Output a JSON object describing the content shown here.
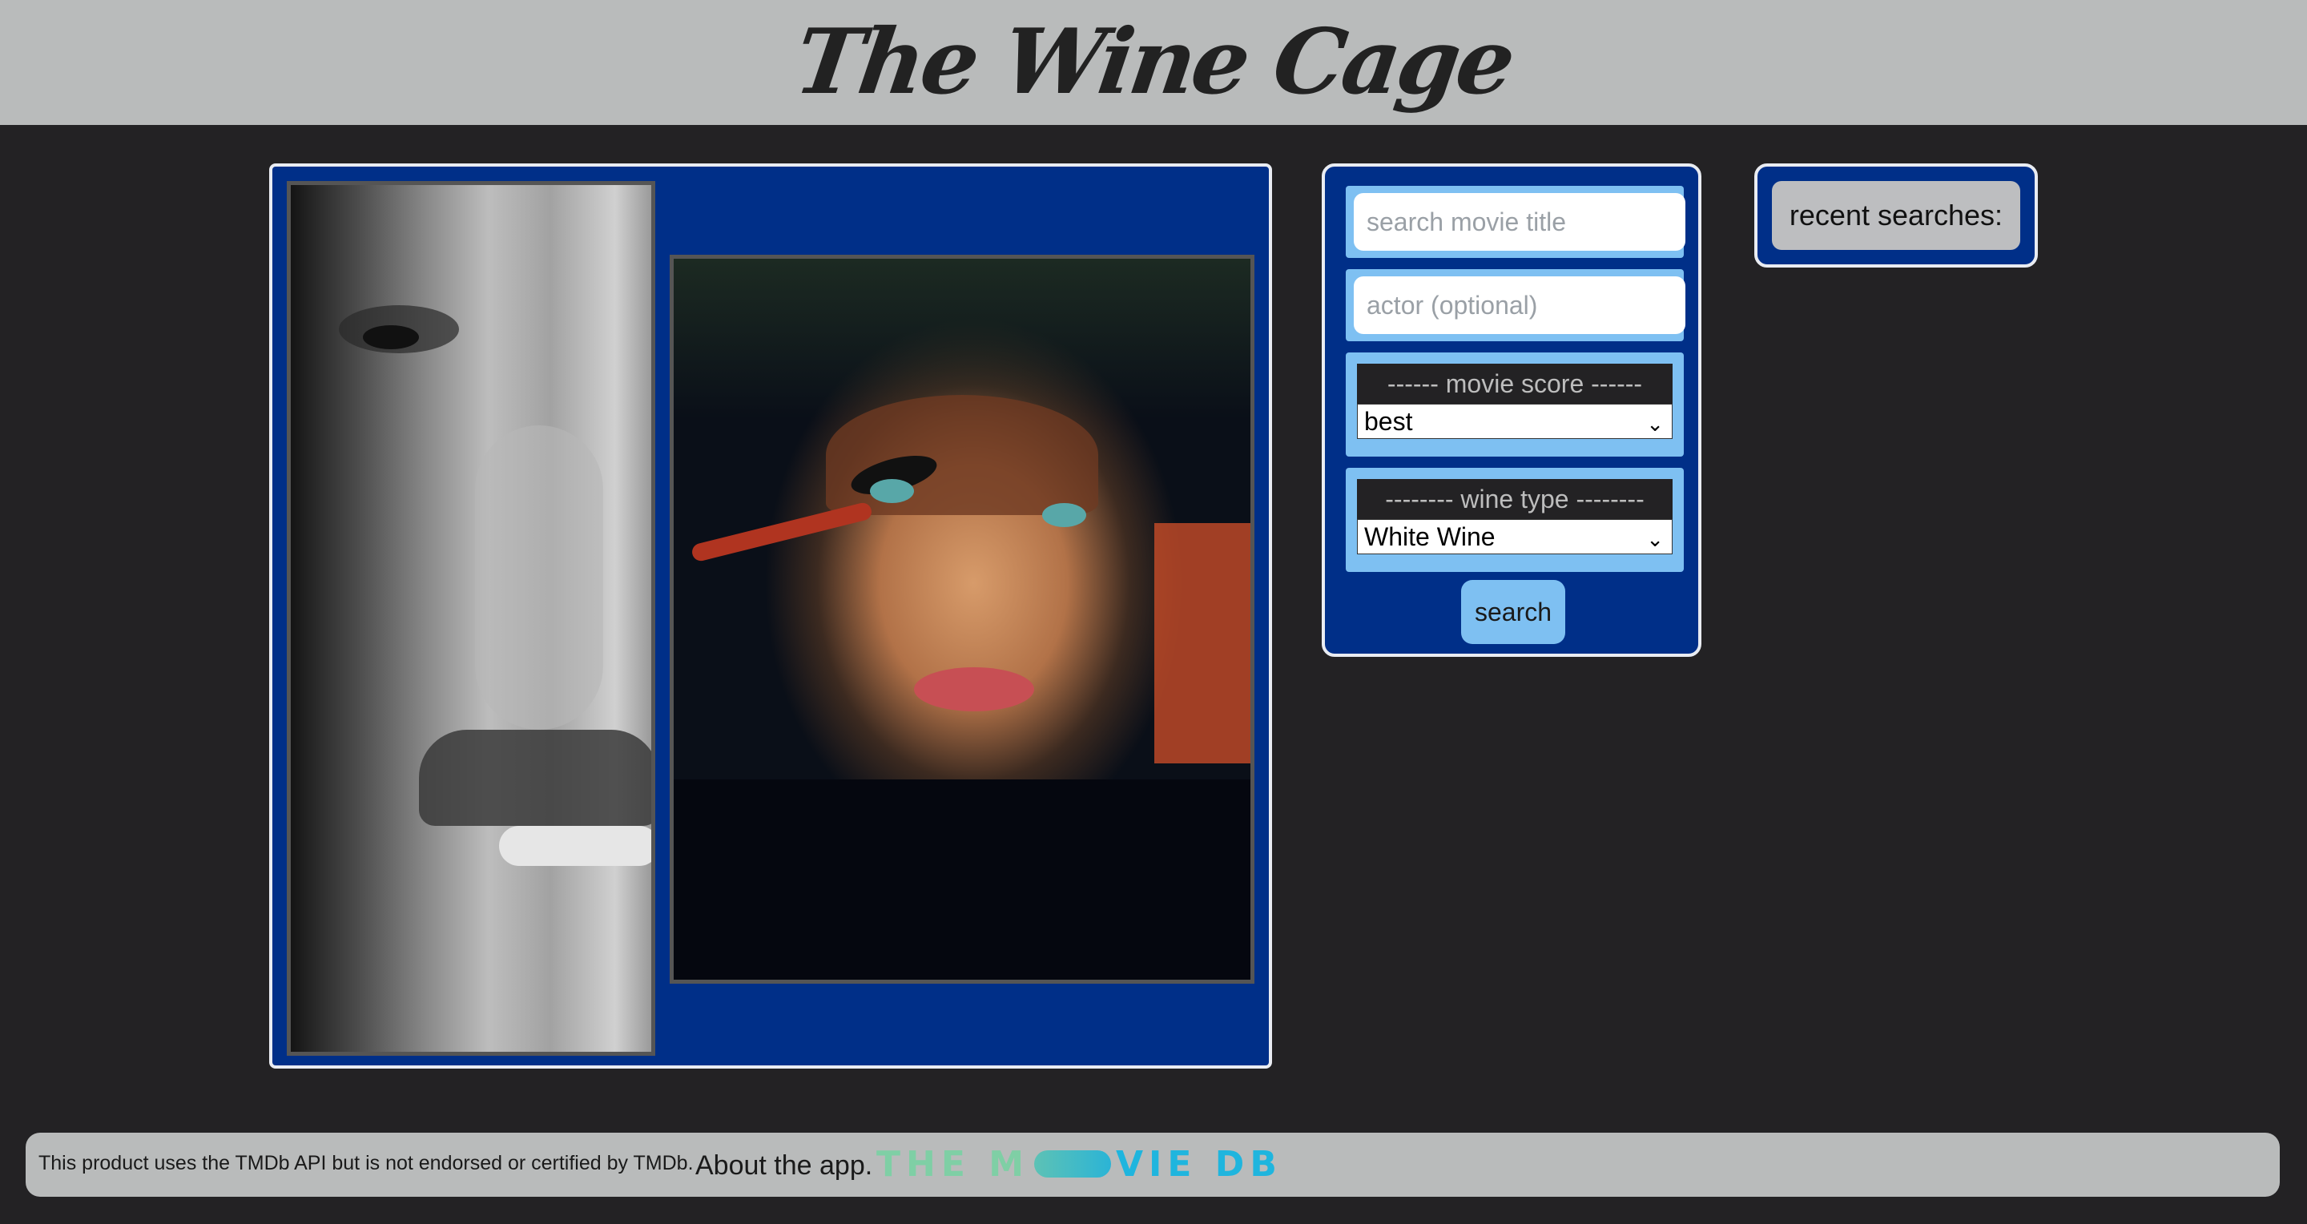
{
  "header": {
    "title": "The Wine Cage"
  },
  "images": {
    "left_alt": "black and white close-up portrait",
    "right_alt": "color portrait applying eye makeup"
  },
  "search": {
    "title_placeholder": "search movie title",
    "actor_placeholder": "actor (optional)",
    "score_label": "------ movie score ------",
    "score_value": "best",
    "wine_label": "-------- wine type --------",
    "wine_value": "White Wine",
    "button_label": "search"
  },
  "recent": {
    "label": "recent searches:"
  },
  "footer": {
    "disclaimer": "This product uses the TMDb API but is not endorsed or certified by TMDb.",
    "about": "About the app.",
    "logo_left": "THE M",
    "logo_right": "VIE DB"
  },
  "colors": {
    "panel_blue": "#002f88",
    "field_blue": "#7ec0f2",
    "background": "#232224",
    "header_gray": "#b9bbbb"
  }
}
